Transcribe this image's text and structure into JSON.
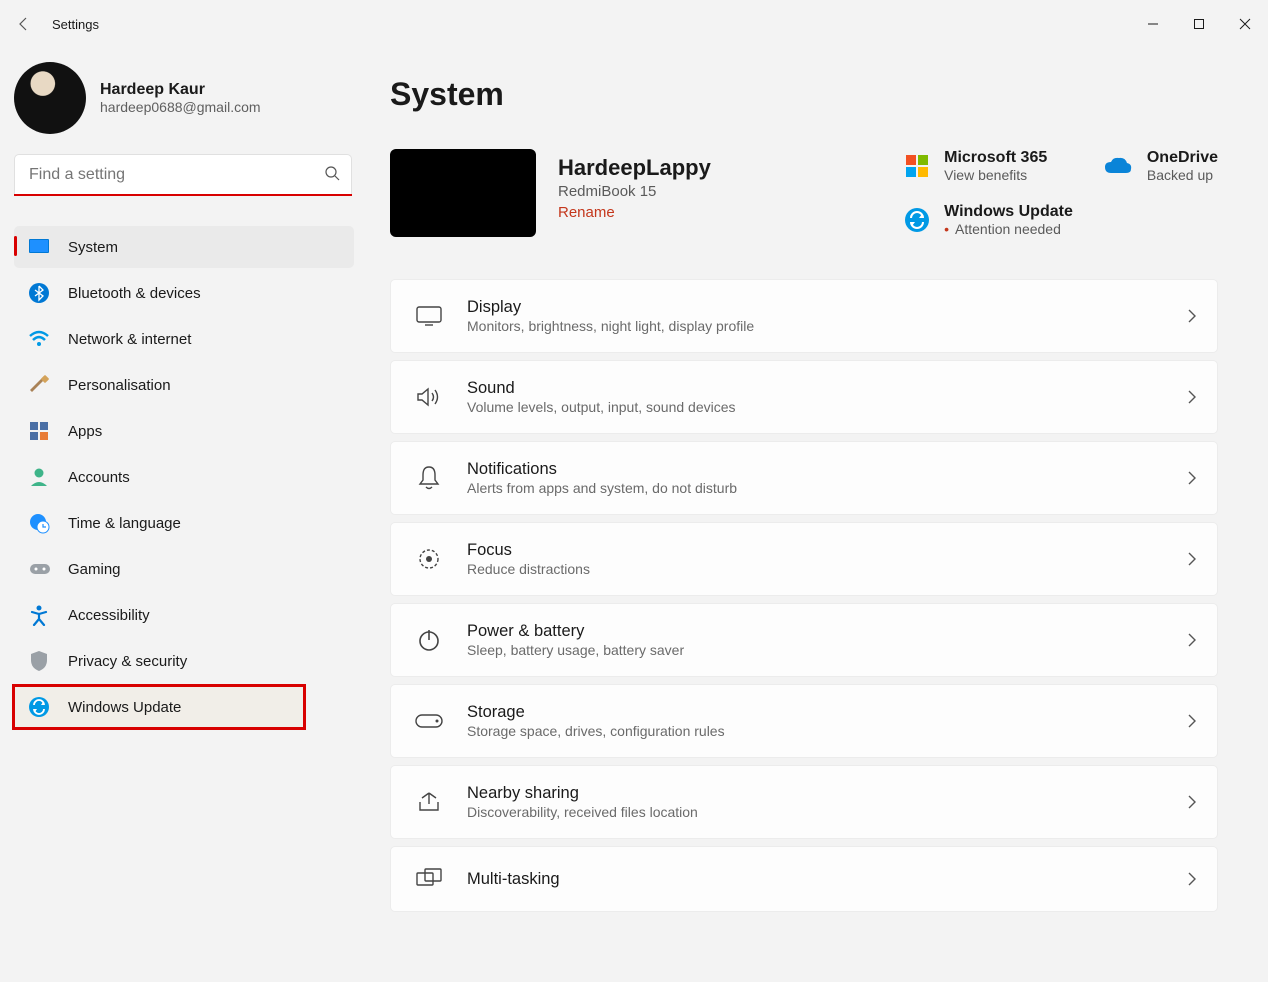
{
  "titlebar": {
    "app_title": "Settings"
  },
  "user": {
    "name": "Hardeep Kaur",
    "email": "hardeep0688@gmail.com"
  },
  "search": {
    "placeholder": "Find a setting"
  },
  "sidebar": {
    "items": [
      {
        "label": "System"
      },
      {
        "label": "Bluetooth & devices"
      },
      {
        "label": "Network & internet"
      },
      {
        "label": "Personalisation"
      },
      {
        "label": "Apps"
      },
      {
        "label": "Accounts"
      },
      {
        "label": "Time & language"
      },
      {
        "label": "Gaming"
      },
      {
        "label": "Accessibility"
      },
      {
        "label": "Privacy & security"
      },
      {
        "label": "Windows Update"
      }
    ]
  },
  "page": {
    "title": "System"
  },
  "device": {
    "name": "HardeepLappy",
    "model": "RedmiBook 15",
    "rename": "Rename"
  },
  "cards": {
    "ms365": {
      "title": "Microsoft 365",
      "sub": "View benefits"
    },
    "onedrive": {
      "title": "OneDrive",
      "sub": "Backed up"
    },
    "winupdate": {
      "title": "Windows Update",
      "sub": "Attention needed"
    }
  },
  "settings": [
    {
      "name": "Display",
      "desc": "Monitors, brightness, night light, display profile"
    },
    {
      "name": "Sound",
      "desc": "Volume levels, output, input, sound devices"
    },
    {
      "name": "Notifications",
      "desc": "Alerts from apps and system, do not disturb"
    },
    {
      "name": "Focus",
      "desc": "Reduce distractions"
    },
    {
      "name": "Power & battery",
      "desc": "Sleep, battery usage, battery saver"
    },
    {
      "name": "Storage",
      "desc": "Storage space, drives, configuration rules"
    },
    {
      "name": "Nearby sharing",
      "desc": "Discoverability, received files location"
    },
    {
      "name": "Multi-tasking",
      "desc": ""
    }
  ]
}
